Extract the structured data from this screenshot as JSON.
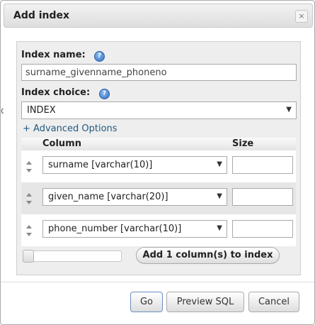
{
  "dialog": {
    "title": "Add index",
    "close_glyph": "×",
    "edge_glyph": "c"
  },
  "form": {
    "index_name_label": "Index name:",
    "index_name_value": "surname_givenname_phoneno",
    "index_choice_label": "Index choice:",
    "index_choice_value": "INDEX",
    "help_glyph": "?",
    "advanced_options": "+ Advanced Options"
  },
  "columns_table": {
    "headers": [
      "Column",
      "Size"
    ],
    "rows": [
      {
        "column": "surname [varchar(10)]",
        "size": ""
      },
      {
        "column": "given_name [varchar(20)]",
        "size": ""
      },
      {
        "column": "phone_number [varchar(10)]",
        "size": ""
      }
    ]
  },
  "add_column": {
    "slider_value": 1,
    "button_label": "Add 1 column(s) to index"
  },
  "footer": {
    "go": "Go",
    "preview_sql": "Preview SQL",
    "cancel": "Cancel"
  },
  "icons": {
    "help": "help-icon",
    "close": "close-icon",
    "drag": "drag-handle-icon",
    "dropdown": "chevron-down-icon"
  },
  "colors": {
    "link": "#235a81",
    "fieldset_bg": "#eeeeee",
    "help_icon": "#2f6fc0"
  }
}
